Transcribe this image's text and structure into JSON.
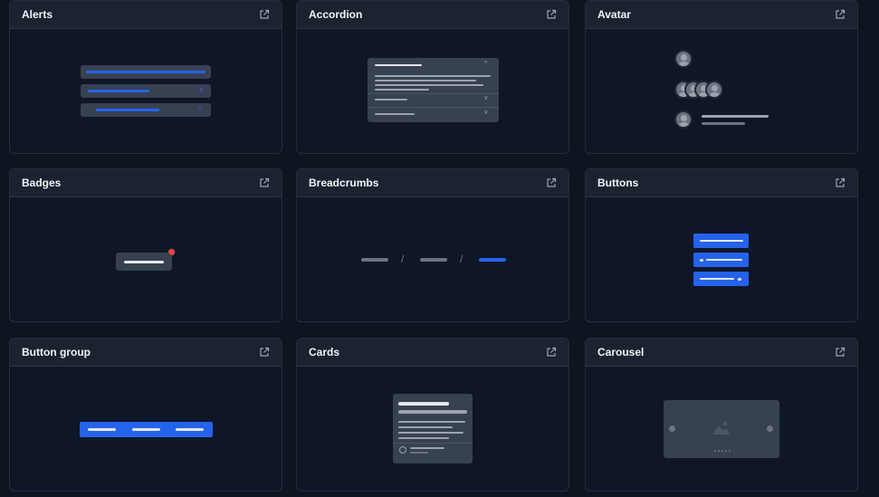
{
  "cards": [
    {
      "title": "Alerts",
      "icon": "external-link-icon"
    },
    {
      "title": "Accordion",
      "icon": "external-link-icon"
    },
    {
      "title": "Avatar",
      "icon": "external-link-icon"
    },
    {
      "title": "Badges",
      "icon": "external-link-icon"
    },
    {
      "title": "Breadcrumbs",
      "icon": "external-link-icon"
    },
    {
      "title": "Buttons",
      "icon": "external-link-icon"
    },
    {
      "title": "Button group",
      "icon": "external-link-icon"
    },
    {
      "title": "Cards",
      "icon": "external-link-icon"
    },
    {
      "title": "Carousel",
      "icon": "external-link-icon"
    }
  ],
  "colors": {
    "background": "#0f1421",
    "card_header": "#1b2331",
    "accent_blue": "#2563eb",
    "badge_red": "#ef4444"
  }
}
